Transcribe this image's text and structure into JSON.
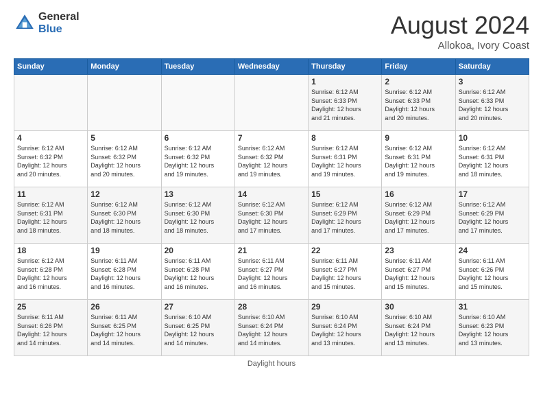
{
  "header": {
    "logo_general": "General",
    "logo_blue": "Blue",
    "month_year": "August 2024",
    "location": "Allokoa, Ivory Coast"
  },
  "days_of_week": [
    "Sunday",
    "Monday",
    "Tuesday",
    "Wednesday",
    "Thursday",
    "Friday",
    "Saturday"
  ],
  "footer": {
    "daylight_label": "Daylight hours"
  },
  "weeks": [
    {
      "days": [
        {
          "number": "",
          "info": ""
        },
        {
          "number": "",
          "info": ""
        },
        {
          "number": "",
          "info": ""
        },
        {
          "number": "",
          "info": ""
        },
        {
          "number": "1",
          "info": "Sunrise: 6:12 AM\nSunset: 6:33 PM\nDaylight: 12 hours\nand 21 minutes."
        },
        {
          "number": "2",
          "info": "Sunrise: 6:12 AM\nSunset: 6:33 PM\nDaylight: 12 hours\nand 20 minutes."
        },
        {
          "number": "3",
          "info": "Sunrise: 6:12 AM\nSunset: 6:33 PM\nDaylight: 12 hours\nand 20 minutes."
        }
      ]
    },
    {
      "days": [
        {
          "number": "4",
          "info": "Sunrise: 6:12 AM\nSunset: 6:32 PM\nDaylight: 12 hours\nand 20 minutes."
        },
        {
          "number": "5",
          "info": "Sunrise: 6:12 AM\nSunset: 6:32 PM\nDaylight: 12 hours\nand 20 minutes."
        },
        {
          "number": "6",
          "info": "Sunrise: 6:12 AM\nSunset: 6:32 PM\nDaylight: 12 hours\nand 19 minutes."
        },
        {
          "number": "7",
          "info": "Sunrise: 6:12 AM\nSunset: 6:32 PM\nDaylight: 12 hours\nand 19 minutes."
        },
        {
          "number": "8",
          "info": "Sunrise: 6:12 AM\nSunset: 6:31 PM\nDaylight: 12 hours\nand 19 minutes."
        },
        {
          "number": "9",
          "info": "Sunrise: 6:12 AM\nSunset: 6:31 PM\nDaylight: 12 hours\nand 19 minutes."
        },
        {
          "number": "10",
          "info": "Sunrise: 6:12 AM\nSunset: 6:31 PM\nDaylight: 12 hours\nand 18 minutes."
        }
      ]
    },
    {
      "days": [
        {
          "number": "11",
          "info": "Sunrise: 6:12 AM\nSunset: 6:31 PM\nDaylight: 12 hours\nand 18 minutes."
        },
        {
          "number": "12",
          "info": "Sunrise: 6:12 AM\nSunset: 6:30 PM\nDaylight: 12 hours\nand 18 minutes."
        },
        {
          "number": "13",
          "info": "Sunrise: 6:12 AM\nSunset: 6:30 PM\nDaylight: 12 hours\nand 18 minutes."
        },
        {
          "number": "14",
          "info": "Sunrise: 6:12 AM\nSunset: 6:30 PM\nDaylight: 12 hours\nand 17 minutes."
        },
        {
          "number": "15",
          "info": "Sunrise: 6:12 AM\nSunset: 6:29 PM\nDaylight: 12 hours\nand 17 minutes."
        },
        {
          "number": "16",
          "info": "Sunrise: 6:12 AM\nSunset: 6:29 PM\nDaylight: 12 hours\nand 17 minutes."
        },
        {
          "number": "17",
          "info": "Sunrise: 6:12 AM\nSunset: 6:29 PM\nDaylight: 12 hours\nand 17 minutes."
        }
      ]
    },
    {
      "days": [
        {
          "number": "18",
          "info": "Sunrise: 6:12 AM\nSunset: 6:28 PM\nDaylight: 12 hours\nand 16 minutes."
        },
        {
          "number": "19",
          "info": "Sunrise: 6:11 AM\nSunset: 6:28 PM\nDaylight: 12 hours\nand 16 minutes."
        },
        {
          "number": "20",
          "info": "Sunrise: 6:11 AM\nSunset: 6:28 PM\nDaylight: 12 hours\nand 16 minutes."
        },
        {
          "number": "21",
          "info": "Sunrise: 6:11 AM\nSunset: 6:27 PM\nDaylight: 12 hours\nand 16 minutes."
        },
        {
          "number": "22",
          "info": "Sunrise: 6:11 AM\nSunset: 6:27 PM\nDaylight: 12 hours\nand 15 minutes."
        },
        {
          "number": "23",
          "info": "Sunrise: 6:11 AM\nSunset: 6:27 PM\nDaylight: 12 hours\nand 15 minutes."
        },
        {
          "number": "24",
          "info": "Sunrise: 6:11 AM\nSunset: 6:26 PM\nDaylight: 12 hours\nand 15 minutes."
        }
      ]
    },
    {
      "days": [
        {
          "number": "25",
          "info": "Sunrise: 6:11 AM\nSunset: 6:26 PM\nDaylight: 12 hours\nand 14 minutes."
        },
        {
          "number": "26",
          "info": "Sunrise: 6:11 AM\nSunset: 6:25 PM\nDaylight: 12 hours\nand 14 minutes."
        },
        {
          "number": "27",
          "info": "Sunrise: 6:10 AM\nSunset: 6:25 PM\nDaylight: 12 hours\nand 14 minutes."
        },
        {
          "number": "28",
          "info": "Sunrise: 6:10 AM\nSunset: 6:24 PM\nDaylight: 12 hours\nand 14 minutes."
        },
        {
          "number": "29",
          "info": "Sunrise: 6:10 AM\nSunset: 6:24 PM\nDaylight: 12 hours\nand 13 minutes."
        },
        {
          "number": "30",
          "info": "Sunrise: 6:10 AM\nSunset: 6:24 PM\nDaylight: 12 hours\nand 13 minutes."
        },
        {
          "number": "31",
          "info": "Sunrise: 6:10 AM\nSunset: 6:23 PM\nDaylight: 12 hours\nand 13 minutes."
        }
      ]
    }
  ]
}
